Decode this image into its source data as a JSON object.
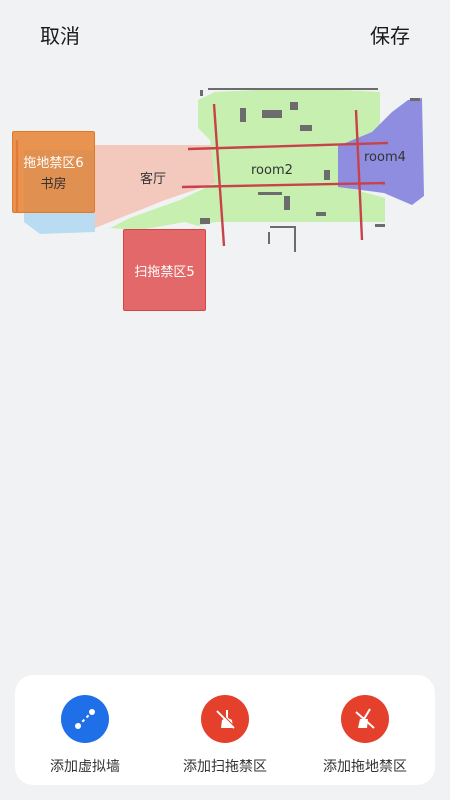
{
  "header": {
    "cancel_label": "取消",
    "save_label": "保存"
  },
  "map": {
    "rooms": {
      "study": "书房",
      "living": "客厅",
      "room2": "room2",
      "room4": "room4"
    },
    "zones": {
      "mop": "拖地禁区6",
      "sweep": "扫拖禁区5"
    },
    "colors": {
      "study": "#b9dcf3",
      "living": "#f3c9bd",
      "room2": "#c6efb0",
      "room4": "#8e8de0",
      "wall": "#c8424a",
      "mop_zone": "#e6843a",
      "sweep_zone": "#e05252"
    }
  },
  "actions": {
    "add_wall": {
      "label": "添加虚拟墙",
      "icon": "virtual-wall-icon",
      "color": "#1e6fe8"
    },
    "add_sweep_zone": {
      "label": "添加扫拖禁区",
      "icon": "broom-no-go-icon",
      "color": "#e4402b"
    },
    "add_mop_zone": {
      "label": "添加拖地禁区",
      "icon": "mop-no-go-icon",
      "color": "#e4402b"
    }
  }
}
